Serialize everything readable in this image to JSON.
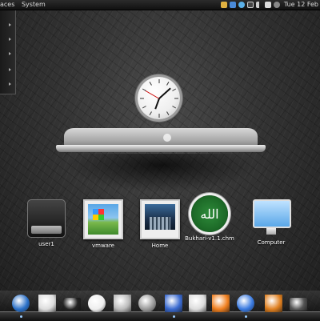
{
  "top_panel": {
    "menu": [
      "aces",
      "System"
    ],
    "clock": "Tue 12 Feb",
    "tray_icons": [
      {
        "name": "folder-icon",
        "color": "#e0b040"
      },
      {
        "name": "network-icon",
        "color": "#4a8ad8"
      },
      {
        "name": "chat-icon",
        "color": "#5bb0e8"
      },
      {
        "name": "bluetooth-icon",
        "color": "#ccc"
      },
      {
        "name": "volume-icon",
        "color": "#ccc"
      },
      {
        "name": "mail-icon",
        "color": "#ddd"
      },
      {
        "name": "power-icon",
        "color": "#aaa"
      }
    ]
  },
  "clock_widget": {
    "name": "analog-clock"
  },
  "desktop_icons": [
    {
      "id": "user1",
      "label": "user1",
      "icon": "hard-drive-icon"
    },
    {
      "id": "vmware",
      "label": "vmware",
      "icon": "vmware-image-icon"
    },
    {
      "id": "home",
      "label": "Home",
      "icon": "home-folder-icon"
    },
    {
      "id": "bukhari",
      "label": "Bukhari-v1.1.chm",
      "icon": "chm-file-icon",
      "glyph": "الله"
    },
    {
      "id": "computer",
      "label": "Computer",
      "icon": "computer-icon"
    }
  ],
  "dock_items": [
    {
      "name": "firefox-icon",
      "color": "#2a70c8"
    },
    {
      "name": "media-player-icon",
      "color": "#ddd"
    },
    {
      "name": "terminal-icon",
      "color": "#222"
    },
    {
      "name": "inkscape-icon",
      "color": "#eee"
    },
    {
      "name": "file-manager-icon",
      "color": "#bbb"
    },
    {
      "name": "settings-icon",
      "color": "#999"
    },
    {
      "name": "writer-icon",
      "color": "#3a6ad0"
    },
    {
      "name": "text-editor-icon",
      "color": "#ddd"
    },
    {
      "name": "vlc-icon",
      "color": "#f08020"
    },
    {
      "name": "google-earth-icon",
      "color": "#3a7ae0"
    },
    {
      "name": "virtualbox-icon",
      "color": "#e08020"
    },
    {
      "name": "system-monitor-icon",
      "color": "#555"
    }
  ]
}
